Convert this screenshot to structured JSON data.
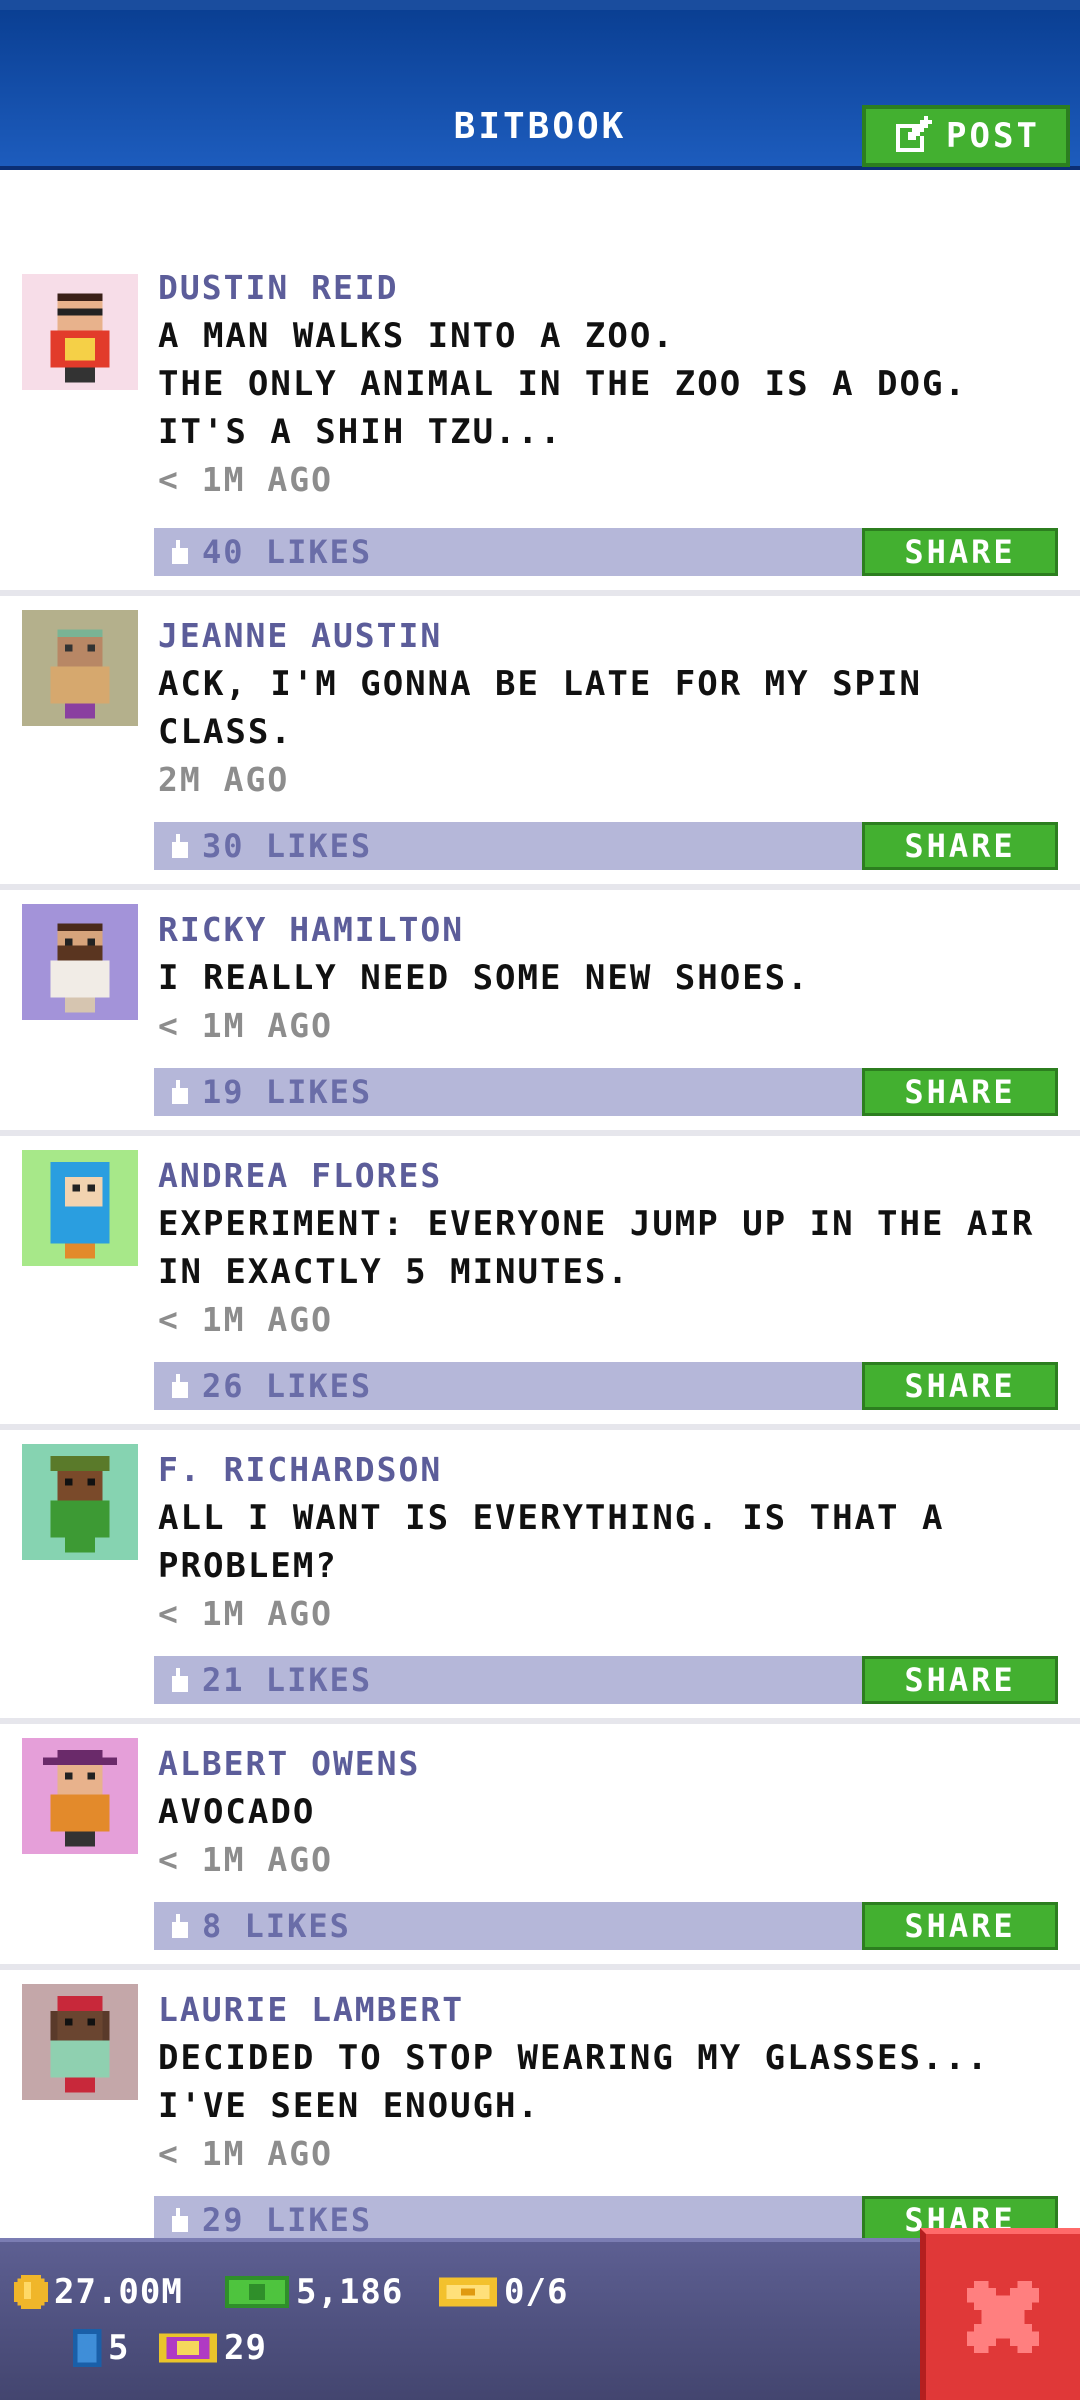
{
  "header": {
    "title": "BITBOOK",
    "post_label": "POST"
  },
  "posts": [
    {
      "author": "DUSTIN REID",
      "text": "A MAN WALKS INTO A ZOO.\nTHE ONLY ANIMAL IN THE ZOO IS A DOG.\nIT'S A SHIH TZU...",
      "time": "< 1M AGO",
      "likes": "40 LIKES",
      "share_label": "SHARE",
      "avatar_bg": "#f7dde8",
      "avatar_icon": "masked-bandit-avatar"
    },
    {
      "author": "JEANNE AUSTIN",
      "text": "ACK, I'M GONNA BE LATE FOR MY SPIN\nCLASS.",
      "time": "2M AGO",
      "likes": "30 LIKES",
      "share_label": "SHARE",
      "avatar_bg": "#b4b08c",
      "avatar_icon": "bald-person-avatar"
    },
    {
      "author": "RICKY HAMILTON",
      "text": "I REALLY NEED SOME NEW SHOES.",
      "time": "< 1M AGO",
      "likes": "19 LIKES",
      "share_label": "SHARE",
      "avatar_bg": "#a393d9",
      "avatar_icon": "bearded-man-avatar"
    },
    {
      "author": "ANDREA FLORES",
      "text": "EXPERIMENT: EVERYONE JUMP UP IN THE AIR\nIN EXACTLY 5 MINUTES.",
      "time": "< 1M AGO",
      "likes": "26 LIKES",
      "share_label": "SHARE",
      "avatar_bg": "#a7e889",
      "avatar_icon": "blue-hair-avatar"
    },
    {
      "author": "F. RICHARDSON",
      "text": "ALL I WANT IS EVERYTHING. IS THAT A\nPROBLEM?",
      "time": "< 1M AGO",
      "likes": "21 LIKES",
      "share_label": "SHARE",
      "avatar_bg": "#86d3b1",
      "avatar_icon": "green-cap-avatar"
    },
    {
      "author": "ALBERT OWENS",
      "text": "AVOCADO",
      "time": "< 1M AGO",
      "likes": "8 LIKES",
      "share_label": "SHARE",
      "avatar_bg": "#e59fd9",
      "avatar_icon": "purple-hat-avatar"
    },
    {
      "author": "LAURIE LAMBERT",
      "text": "DECIDED TO STOP WEARING MY GLASSES...\nI'VE SEEN ENOUGH.",
      "time": "< 1M AGO",
      "likes": "29 LIKES",
      "share_label": "SHARE",
      "avatar_bg": "#c4a7a9",
      "avatar_icon": "red-hat-avatar"
    }
  ],
  "status": {
    "coins": "27.00M",
    "bux": "5,186",
    "tickets": "0/6",
    "elevators": "5",
    "vip": "29"
  },
  "colors": {
    "header_blue": "#1d5cbd",
    "share_green": "#43b030",
    "likes_bar": "#b5b7d9",
    "close_red": "#e03838"
  }
}
